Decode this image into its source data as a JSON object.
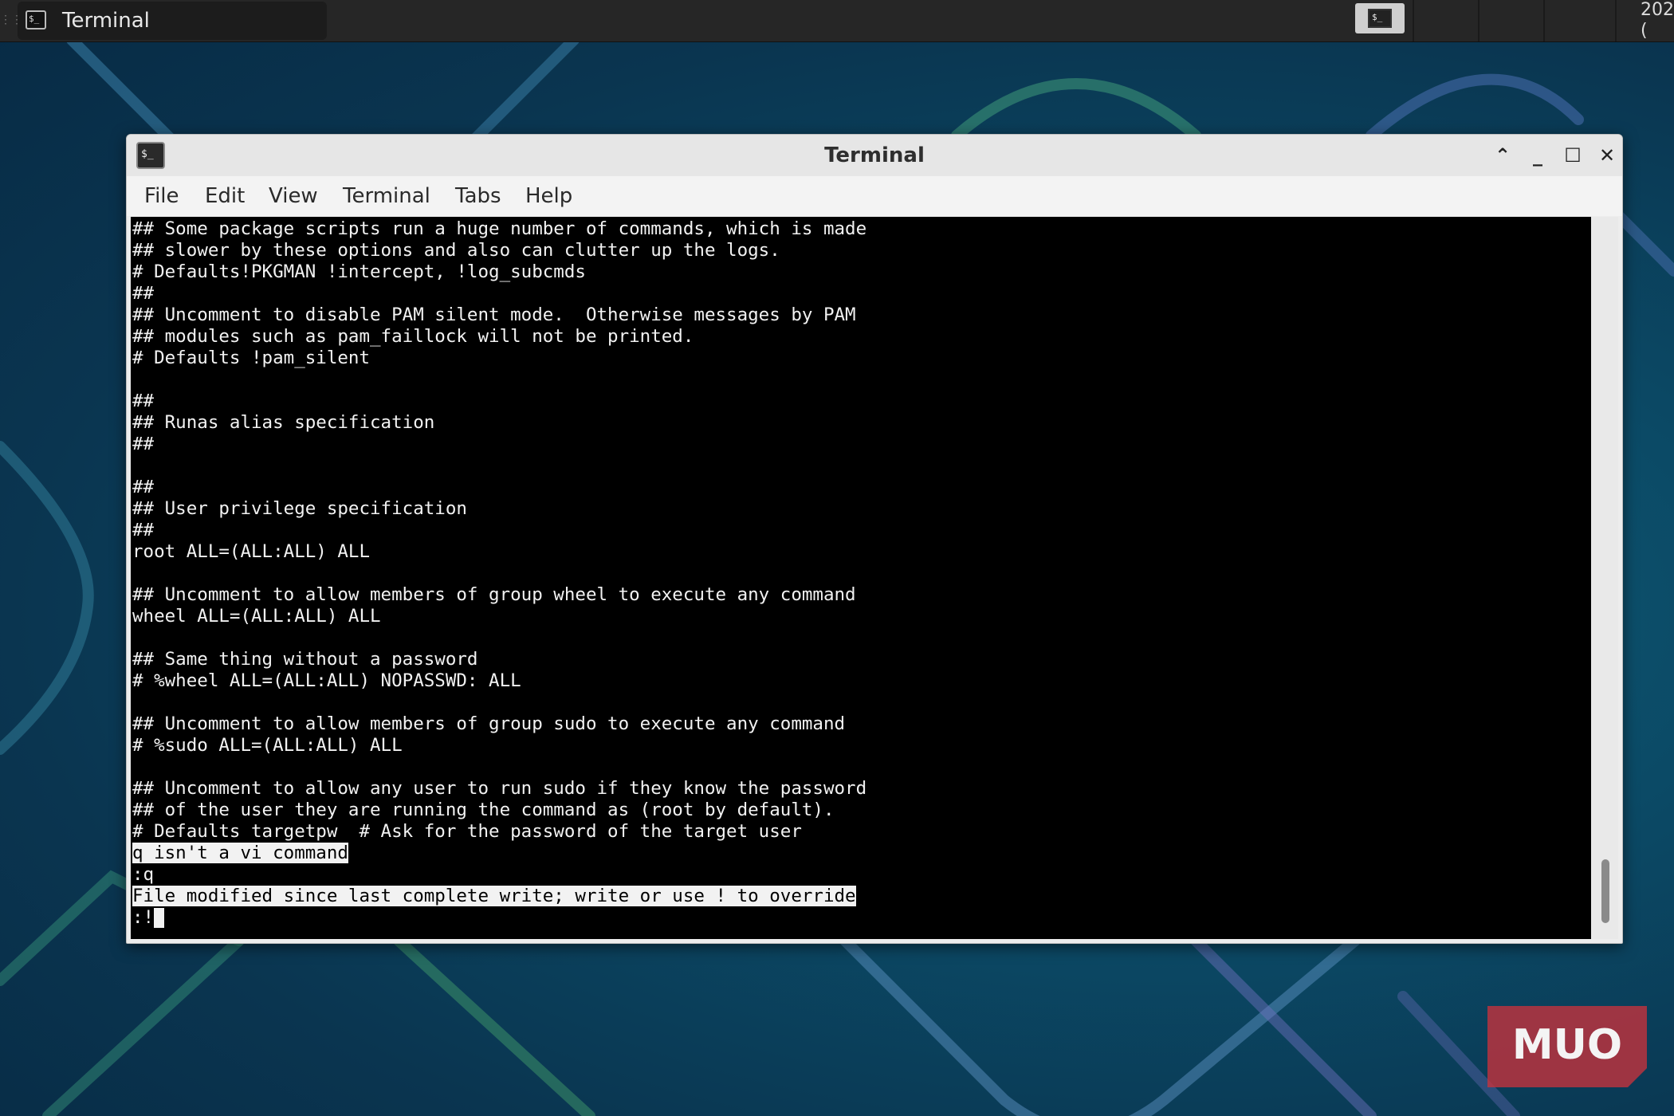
{
  "taskbar": {
    "task_label": "Terminal",
    "clock_text": "202\n(",
    "task_icon_glyph": "$_",
    "tray_icon_glyph": "$_"
  },
  "window": {
    "title": "Terminal",
    "app_icon_glyph": "$_",
    "controls": {
      "rollup": "⌃",
      "minimize": "_",
      "maximize": "☐",
      "close": "✕"
    }
  },
  "menu": [
    "File",
    "Edit",
    "View",
    "Terminal",
    "Tabs",
    "Help"
  ],
  "terminal": {
    "lines": [
      "## Some package scripts run a huge number of commands, which is made",
      "## slower by these options and also can clutter up the logs.",
      "# Defaults!PKGMAN !intercept, !log_subcmds",
      "##",
      "## Uncomment to disable PAM silent mode.  Otherwise messages by PAM",
      "## modules such as pam_faillock will not be printed.",
      "# Defaults !pam_silent",
      "",
      "##",
      "## Runas alias specification",
      "##",
      "",
      "##",
      "## User privilege specification",
      "##",
      "root ALL=(ALL:ALL) ALL",
      "",
      "## Uncomment to allow members of group wheel to execute any command",
      "wheel ALL=(ALL:ALL) ALL",
      "",
      "## Same thing without a password",
      "# %wheel ALL=(ALL:ALL) NOPASSWD: ALL",
      "",
      "## Uncomment to allow members of group sudo to execute any command",
      "# %sudo ALL=(ALL:ALL) ALL",
      "",
      "## Uncomment to allow any user to run sudo if they know the password",
      "## of the user they are running the command as (root by default).",
      "# Defaults targetpw  # Ask for the password of the target user"
    ],
    "error_message": "q isn't a vi command",
    "quit_command": ":q",
    "warning_message": "File modified since last complete write; write or use ! to override",
    "prompt": ":!"
  },
  "watermark": {
    "text": "MUO"
  },
  "colors": {
    "terminal_bg": "#000000",
    "terminal_fg": "#f2f2f2",
    "logo_red": "#c8323c"
  }
}
